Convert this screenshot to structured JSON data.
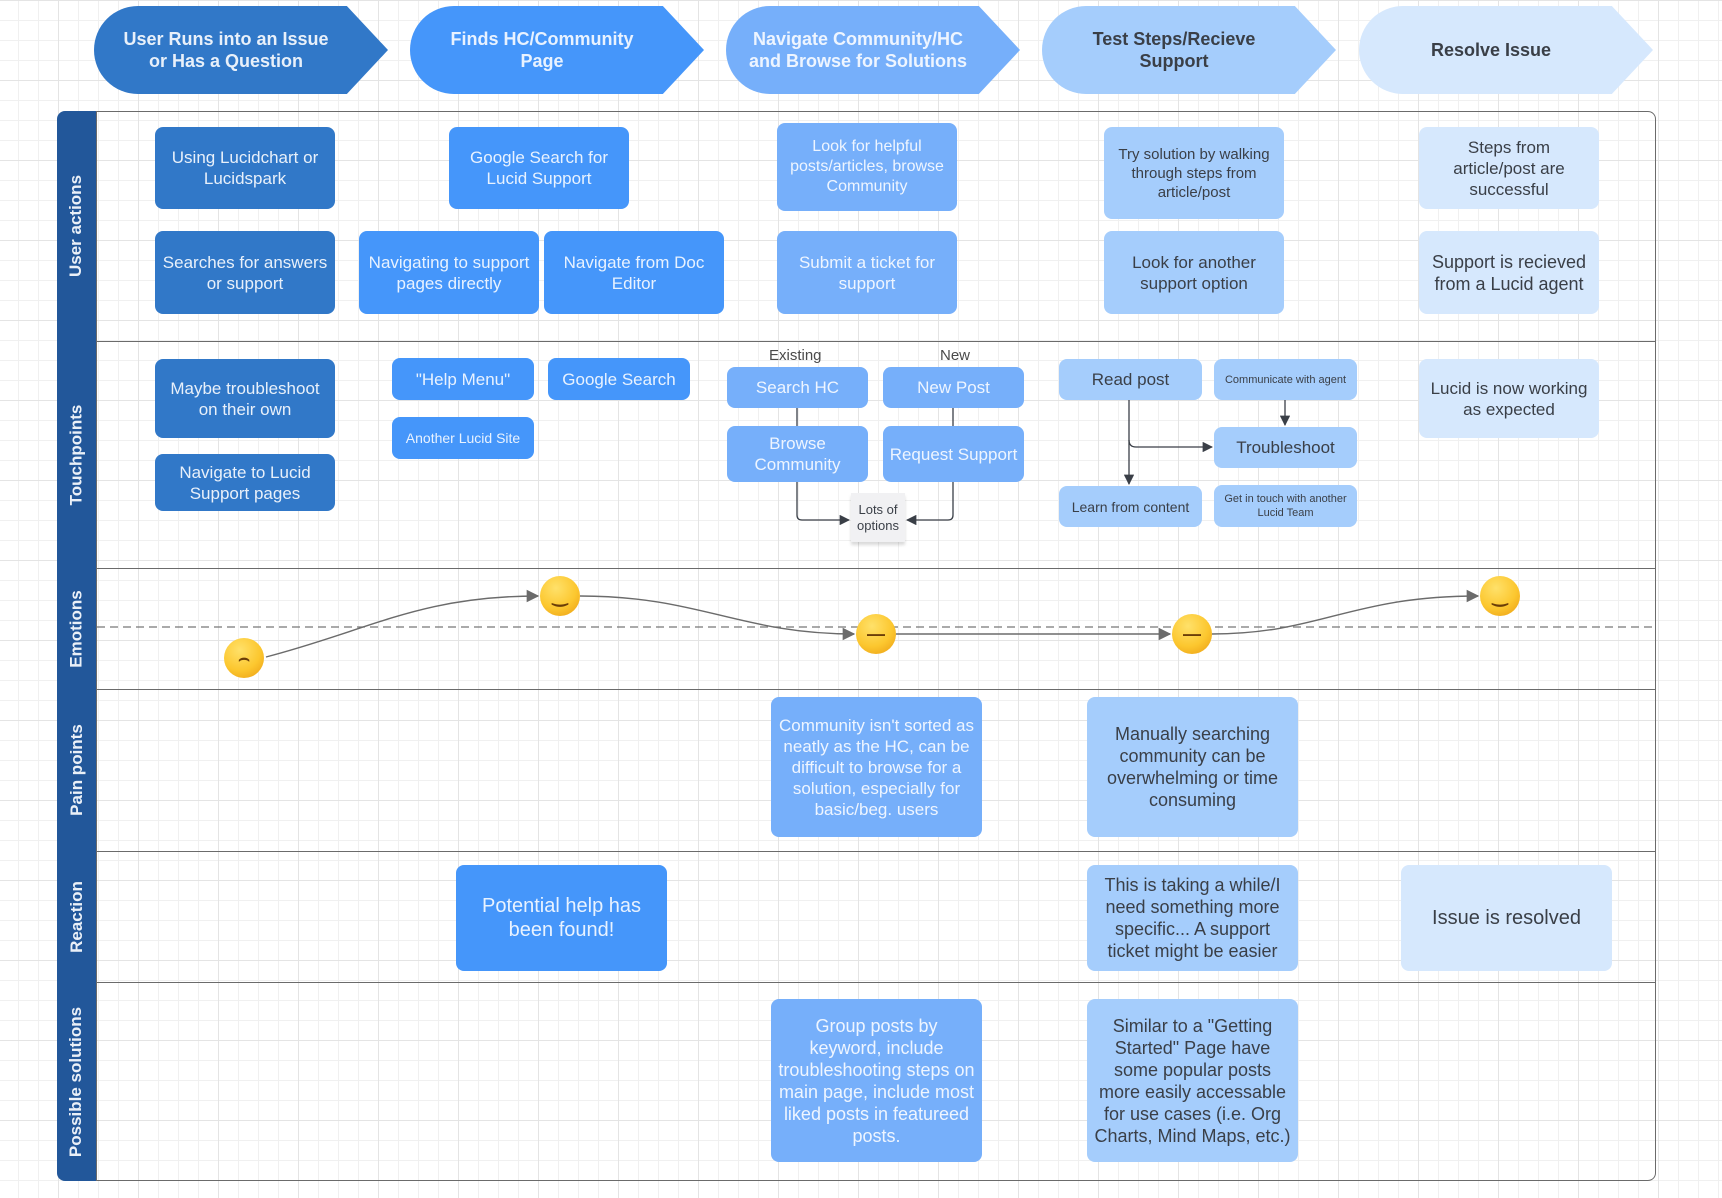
{
  "phases": [
    {
      "label": "User Runs into an Issue or Has a Question"
    },
    {
      "label": "Finds HC/Community Page"
    },
    {
      "label": "Navigate Community/HC and Browse for Solutions"
    },
    {
      "label": "Test Steps/Recieve Support"
    },
    {
      "label": "Resolve Issue"
    }
  ],
  "lanes": [
    {
      "label": "User actions"
    },
    {
      "label": "Touchpoints"
    },
    {
      "label": "Emotions"
    },
    {
      "label": "Pain points"
    },
    {
      "label": "Reaction"
    },
    {
      "label": "Possible solutions"
    }
  ],
  "user_actions": {
    "p1_a": "Using Lucidchart or Lucidspark",
    "p1_b": "Searches for answers or support",
    "p2_a": "Google Search for Lucid Support",
    "p2_b": "Navigating to support pages directly",
    "p2_c": "Navigate from Doc Editor",
    "p3_a": "Look for helpful posts/articles, browse Community",
    "p3_b": "Submit a ticket for support",
    "p4_a": "Try solution by walking through steps from article/post",
    "p4_b": "Look for another support option",
    "p5_a": "Steps from article/post are successful",
    "p5_b": "Support is recieved from a Lucid agent"
  },
  "touchpoints": {
    "p1_a": "Maybe troubleshoot on their own",
    "p1_b": "Navigate to Lucid Support pages",
    "p2_a": "\"Help Menu\"",
    "p2_b": "Google Search",
    "p2_c": "Another Lucid Site",
    "p3_existing_label": "Existing",
    "p3_new_label": "New",
    "p3_search_hc": "Search HC",
    "p3_browse_community": "Browse Community",
    "p3_new_post": "New Post",
    "p3_request_support": "Request Support",
    "p3_note": "Lots of options",
    "p4_read_post": "Read post",
    "p4_communicate": "Communicate with agent",
    "p4_troubleshoot": "Troubleshoot",
    "p4_learn": "Learn from content",
    "p4_get_in_touch": "Get in touch with another Lucid Team",
    "p5_a": "Lucid is now working as expected"
  },
  "emotions": [
    {
      "phase": 1,
      "mood": "crying",
      "icon": "crying-face-icon"
    },
    {
      "phase": 2,
      "mood": "happy",
      "icon": "smiling-face-icon"
    },
    {
      "phase": 3,
      "mood": "neutral",
      "icon": "neutral-face-icon"
    },
    {
      "phase": 4,
      "mood": "neutral",
      "icon": "neutral-face-icon"
    },
    {
      "phase": 5,
      "mood": "happy",
      "icon": "smiling-face-icon"
    }
  ],
  "pain_points": {
    "p3": "Community isn't sorted as neatly as the HC, can be difficult to browse for a solution, especially for basic/beg. users",
    "p4": "Manually searching community can be overwhelming or time consuming"
  },
  "reaction": {
    "p2": "Potential help has been found!",
    "p4": "This is taking a while/I need something more specific... A support ticket might be easier",
    "p5": "Issue is resolved"
  },
  "possible_solutions": {
    "p3": "Group posts by keyword, include troubleshooting steps on main page, include most liked posts in featureed posts.",
    "p4": "Similar to a \"Getting Started\" Page have some popular posts more easily accessable for use cases (i.e. Org Charts, Mind Maps, etc.)"
  },
  "colors": {
    "phase1": "#3178c8",
    "phase2": "#4596fa",
    "phase3": "#76affa",
    "phase4": "#a5cdfc",
    "phase5": "#d6e8fd",
    "lane_label": "#22579a"
  }
}
